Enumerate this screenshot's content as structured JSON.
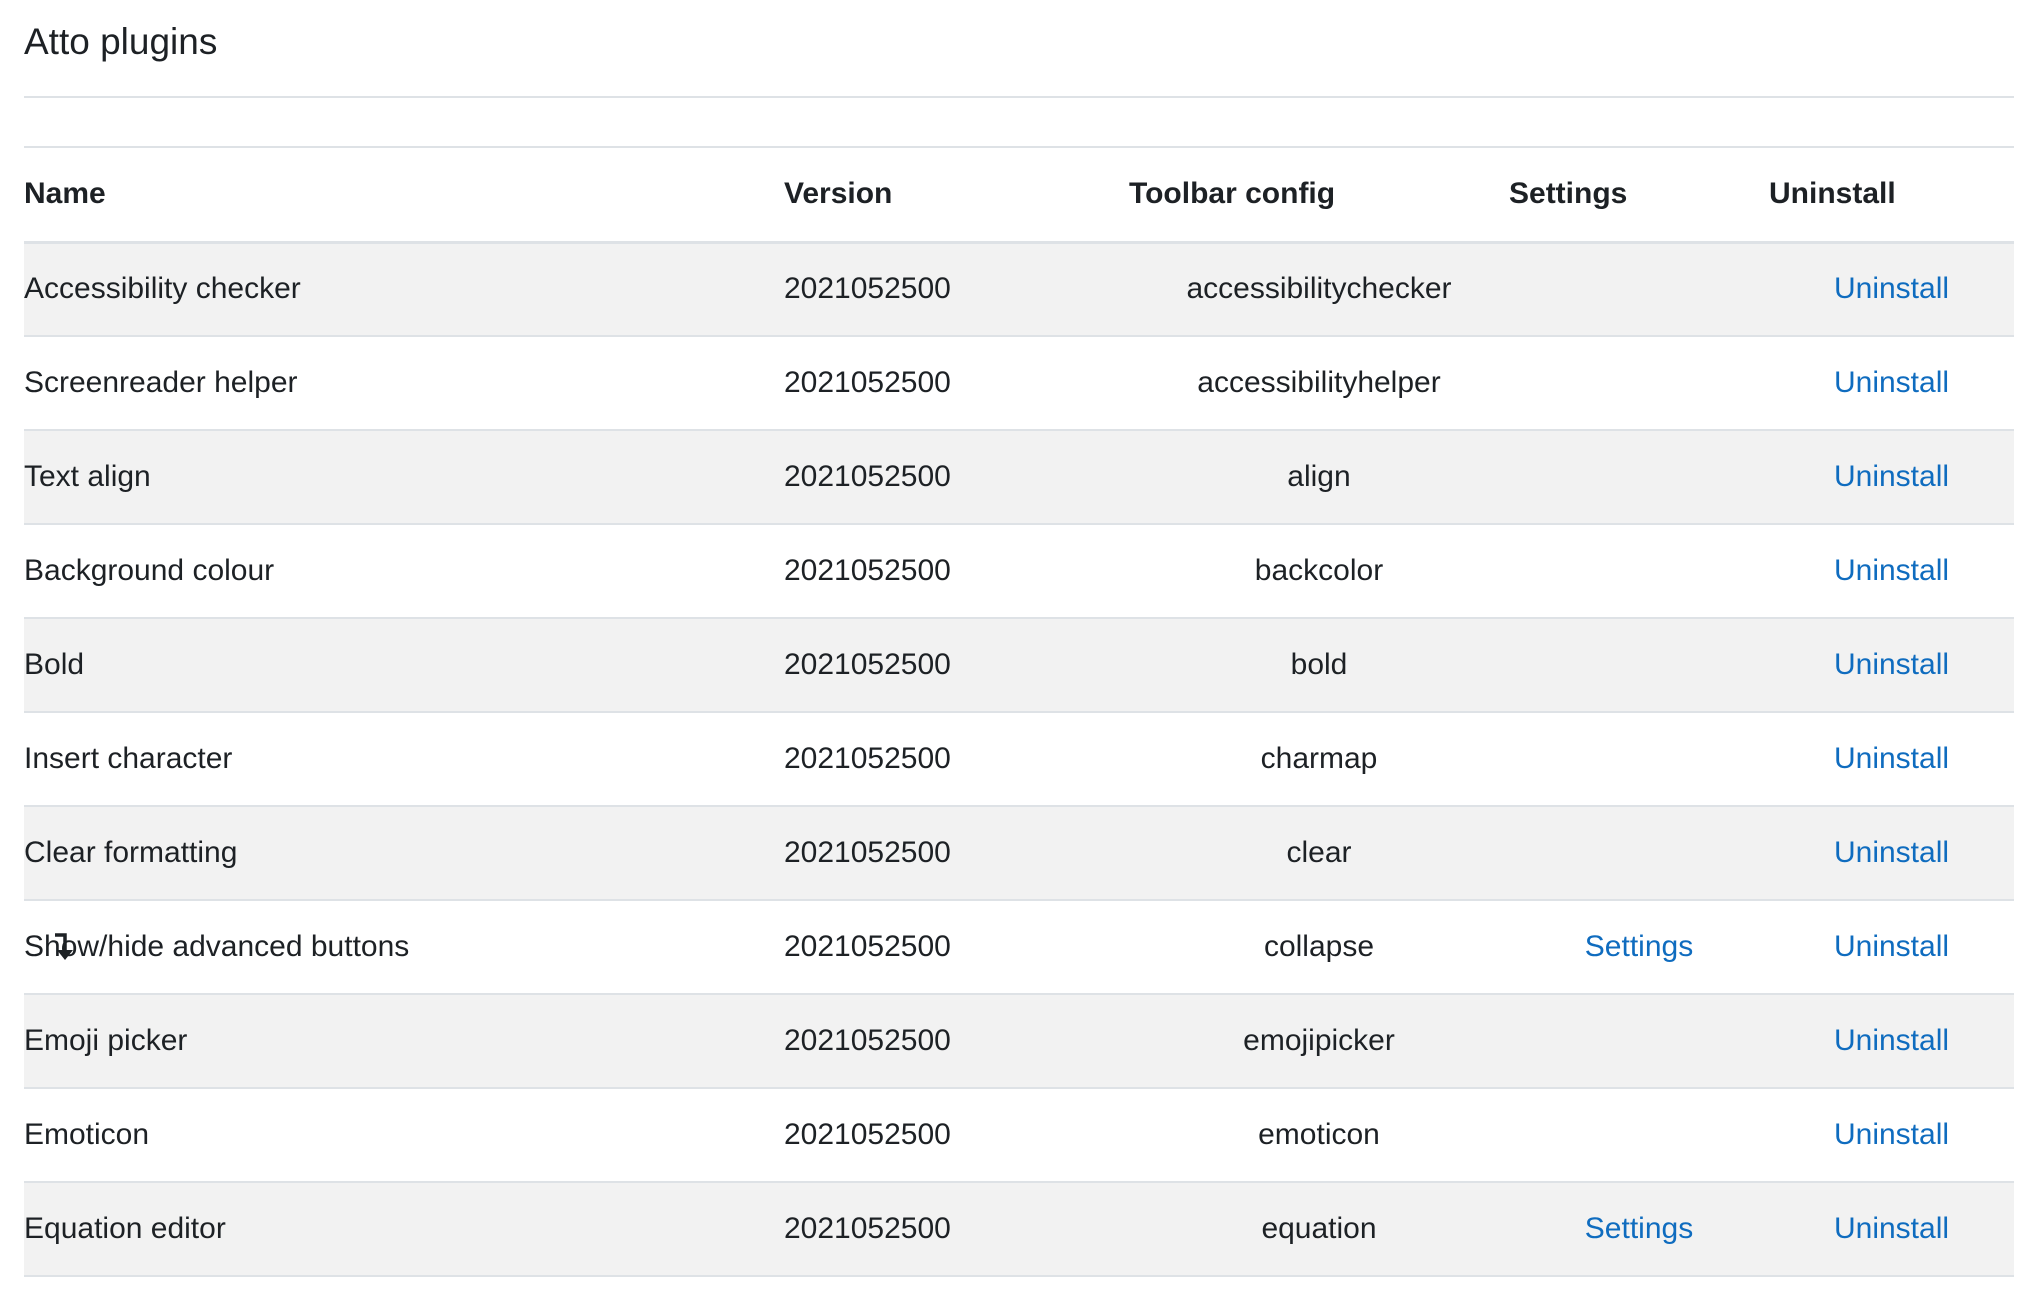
{
  "page": {
    "title": "Atto plugins"
  },
  "table": {
    "headers": {
      "name": "Name",
      "version": "Version",
      "toolbar": "Toolbar config",
      "settings": "Settings",
      "uninstall": "Uninstall"
    },
    "rows": [
      {
        "name": "Accessibility checker",
        "version": "2021052500",
        "toolbar": "accessibilitychecker",
        "settings": "",
        "uninstall": "Uninstall",
        "icon": ""
      },
      {
        "name": "Screenreader helper",
        "version": "2021052500",
        "toolbar": "accessibilityhelper",
        "settings": "",
        "uninstall": "Uninstall",
        "icon": ""
      },
      {
        "name": "Text align",
        "version": "2021052500",
        "toolbar": "align",
        "settings": "",
        "uninstall": "Uninstall",
        "icon": ""
      },
      {
        "name": "Background colour",
        "version": "2021052500",
        "toolbar": "backcolor",
        "settings": "",
        "uninstall": "Uninstall",
        "icon": ""
      },
      {
        "name": "Bold",
        "version": "2021052500",
        "toolbar": "bold",
        "settings": "",
        "uninstall": "Uninstall",
        "icon": ""
      },
      {
        "name": "Insert character",
        "version": "2021052500",
        "toolbar": "charmap",
        "settings": "",
        "uninstall": "Uninstall",
        "icon": ""
      },
      {
        "name": "Clear formatting",
        "version": "2021052500",
        "toolbar": "clear",
        "settings": "",
        "uninstall": "Uninstall",
        "icon": ""
      },
      {
        "name": "Show/hide advanced buttons",
        "version": "2021052500",
        "toolbar": "collapse",
        "settings": "Settings",
        "uninstall": "Uninstall",
        "icon": "arrow-down-right-icon"
      },
      {
        "name": "Emoji picker",
        "version": "2021052500",
        "toolbar": "emojipicker",
        "settings": "",
        "uninstall": "Uninstall",
        "icon": ""
      },
      {
        "name": "Emoticon",
        "version": "2021052500",
        "toolbar": "emoticon",
        "settings": "",
        "uninstall": "Uninstall",
        "icon": ""
      },
      {
        "name": "Equation editor",
        "version": "2021052500",
        "toolbar": "equation",
        "settings": "Settings",
        "uninstall": "Uninstall",
        "icon": ""
      }
    ]
  },
  "colors": {
    "link": "#0f6cbf",
    "stripe": "#f2f2f2",
    "border": "#dee2e6",
    "text": "#1d2125"
  }
}
